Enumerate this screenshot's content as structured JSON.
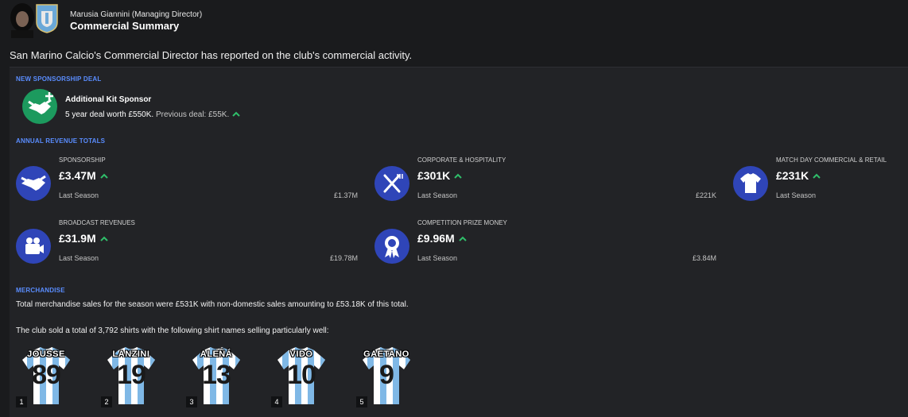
{
  "header": {
    "sender": "Marusia Giannini  (Managing Director)",
    "subject": "Commercial Summary"
  },
  "intro": "San Marino Calcio's Commercial Director has reported on the club's commercial activity.",
  "sponsorship_deal": {
    "section_title": "NEW SPONSORSHIP DEAL",
    "name": "Additional Kit Sponsor",
    "deal": "5 year deal worth £550K.",
    "previous": "Previous deal: £55K."
  },
  "revenue": {
    "section_title": "ANNUAL REVENUE TOTALS",
    "last_season_label": "Last Season",
    "items": [
      {
        "label": "SPONSORSHIP",
        "value": "£3.47M",
        "previous": "£1.37M",
        "icon": "handshake-icon"
      },
      {
        "label": "CORPORATE & HOSPITALITY",
        "value": "£301K",
        "previous": "£221K",
        "icon": "cutlery-icon"
      },
      {
        "label": "MATCH DAY COMMERCIAL & RETAIL",
        "value": "£231K",
        "previous": "",
        "icon": "shirt-icon"
      },
      {
        "label": "BROADCAST REVENUES",
        "value": "£31.9M",
        "previous": "£19.78M",
        "icon": "camera-icon"
      },
      {
        "label": "COMPETITION PRIZE MONEY",
        "value": "£9.96M",
        "previous": "£3.84M",
        "icon": "rosette-icon"
      }
    ]
  },
  "merchandise": {
    "section_title": "MERCHANDISE",
    "summary": "Total merchandise sales for the season were £531K with non-domestic sales amounting to £53.18K of this total.",
    "shirts_text": "The club sold a total of 3,792 shirts with the following shirt names selling particularly well:",
    "shirts": [
      {
        "rank": "1",
        "name": "JOUSSE",
        "number": "89"
      },
      {
        "rank": "2",
        "name": "LANZINI",
        "number": "19"
      },
      {
        "rank": "3",
        "name": "ALEÑÁ",
        "number": "13"
      },
      {
        "rank": "4",
        "name": "VIDO",
        "number": "10"
      },
      {
        "rank": "5",
        "name": "GAETANO",
        "number": "9"
      }
    ]
  },
  "colors": {
    "accent": "#5a8dff",
    "icon_blue": "#2f45b8",
    "sponsor_green": "#1c9a5e",
    "up_arrow": "#2fbf6a",
    "shirt_stripe": "#7fb8e6"
  }
}
